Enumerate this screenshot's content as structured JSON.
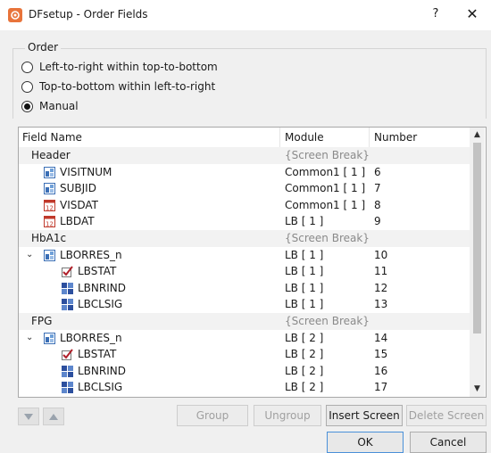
{
  "window": {
    "title": "DFsetup - Order Fields",
    "help_label": "?",
    "close_label": "✕"
  },
  "order": {
    "label": "Order",
    "options": [
      {
        "label": "Left-to-right within top-to-bottom",
        "checked": false
      },
      {
        "label": "Top-to-bottom within left-to-right",
        "checked": false
      },
      {
        "label": "Manual",
        "checked": true
      }
    ]
  },
  "table": {
    "columns": [
      "Field Name",
      "Module",
      "Number"
    ],
    "rows": [
      {
        "type": "break",
        "name": "Header",
        "module": "{Screen Break}",
        "number": ""
      },
      {
        "type": "field",
        "icon": "field-icon",
        "indent": 1,
        "name": "VISITNUM",
        "module": "Common1 [ 1 ]",
        "number": "6"
      },
      {
        "type": "field",
        "icon": "field-icon",
        "indent": 1,
        "name": "SUBJID",
        "module": "Common1 [ 1 ]",
        "number": "7"
      },
      {
        "type": "field",
        "icon": "date-icon",
        "indent": 1,
        "name": "VISDAT",
        "module": "Common1 [ 1 ]",
        "number": "8",
        "icon_text": "12"
      },
      {
        "type": "field",
        "icon": "date-icon",
        "indent": 1,
        "name": "LBDAT",
        "module": "LB [ 1 ]",
        "number": "9",
        "icon_text": "12"
      },
      {
        "type": "break",
        "name": "HbA1c",
        "module": "{Screen Break}",
        "number": ""
      },
      {
        "type": "field",
        "icon": "field-icon",
        "indent": 1,
        "expanded": true,
        "name": "LBORRES_n",
        "module": "LB [ 1 ]",
        "number": "10"
      },
      {
        "type": "field",
        "icon": "check-icon",
        "indent": 2,
        "name": "LBSTAT",
        "module": "LB [ 1 ]",
        "number": "11"
      },
      {
        "type": "field",
        "icon": "grid-icon",
        "indent": 2,
        "name": "LBNRIND",
        "module": "LB [ 1 ]",
        "number": "12"
      },
      {
        "type": "field",
        "icon": "grid-icon",
        "indent": 2,
        "name": "LBCLSIG",
        "module": "LB [ 1 ]",
        "number": "13"
      },
      {
        "type": "break",
        "name": "FPG",
        "module": "{Screen Break}",
        "number": ""
      },
      {
        "type": "field",
        "icon": "field-icon",
        "indent": 1,
        "expanded": true,
        "name": "LBORRES_n",
        "module": "LB [ 2 ]",
        "number": "14"
      },
      {
        "type": "field",
        "icon": "check-icon",
        "indent": 2,
        "name": "LBSTAT",
        "module": "LB [ 2 ]",
        "number": "15"
      },
      {
        "type": "field",
        "icon": "grid-icon",
        "indent": 2,
        "name": "LBNRIND",
        "module": "LB [ 2 ]",
        "number": "16"
      },
      {
        "type": "field",
        "icon": "grid-icon",
        "indent": 2,
        "name": "LBCLSIG",
        "module": "LB [ 2 ]",
        "number": "17"
      }
    ]
  },
  "buttons": {
    "move_down_icon": "triangle-down-icon",
    "move_up_icon": "triangle-up-icon",
    "group": "Group",
    "ungroup": "Ungroup",
    "insert_screen": "Insert Screen",
    "delete_screen": "Delete Screen",
    "ok": "OK",
    "cancel": "Cancel"
  },
  "colors": {
    "field_icon": "#3b6fb6",
    "date_icon": "#c0392b",
    "check_icon": "#b0202a",
    "grid_icon": "#2c4f9e",
    "app_icon": "#e8743b"
  }
}
